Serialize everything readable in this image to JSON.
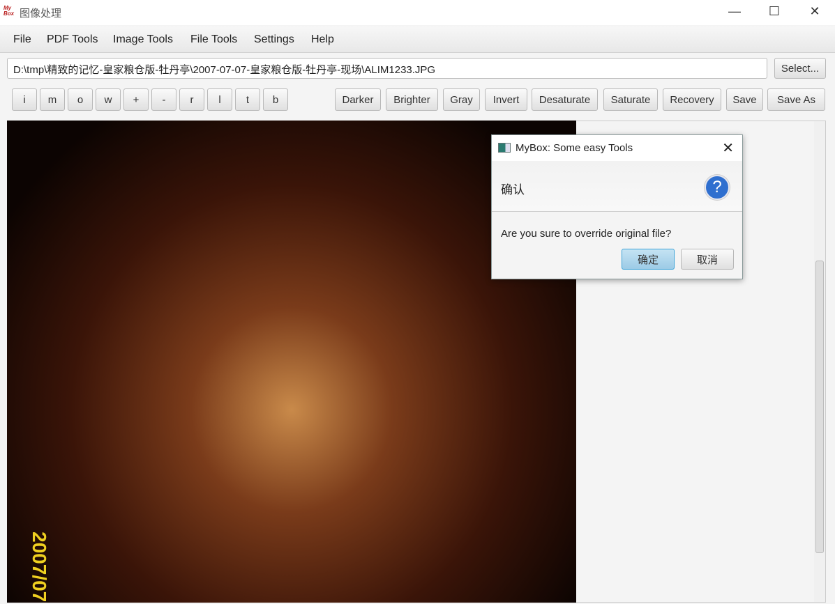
{
  "window": {
    "logo": "My Box",
    "title": "图像处理",
    "minimize": "—",
    "maximize": "☐",
    "close": "✕"
  },
  "menu": [
    "File",
    "PDF Tools",
    "Image Tools",
    "File Tools",
    "Settings",
    "Help"
  ],
  "path": {
    "value": "D:\\tmp\\精致的记忆-皇家粮仓版-牡丹亭\\2007-07-07-皇家粮仓版-牡丹亭-现场\\ALIM1233.JPG",
    "select_label": "Select..."
  },
  "nav_buttons": [
    "i",
    "m",
    "o",
    "w",
    "+",
    "-",
    "r",
    "l",
    "t",
    "b"
  ],
  "action_buttons": [
    "Darker",
    "Brighter",
    "Gray",
    "Invert",
    "Desaturate",
    "Saturate",
    "Recovery",
    "Save",
    "Save As"
  ],
  "image": {
    "stamp": "2007/07"
  },
  "dialog": {
    "title": "MyBox: Some easy Tools",
    "header": "确认",
    "icon": "?",
    "message": "Are you sure to override original file?",
    "ok": "确定",
    "cancel": "取消",
    "close": "✕"
  }
}
